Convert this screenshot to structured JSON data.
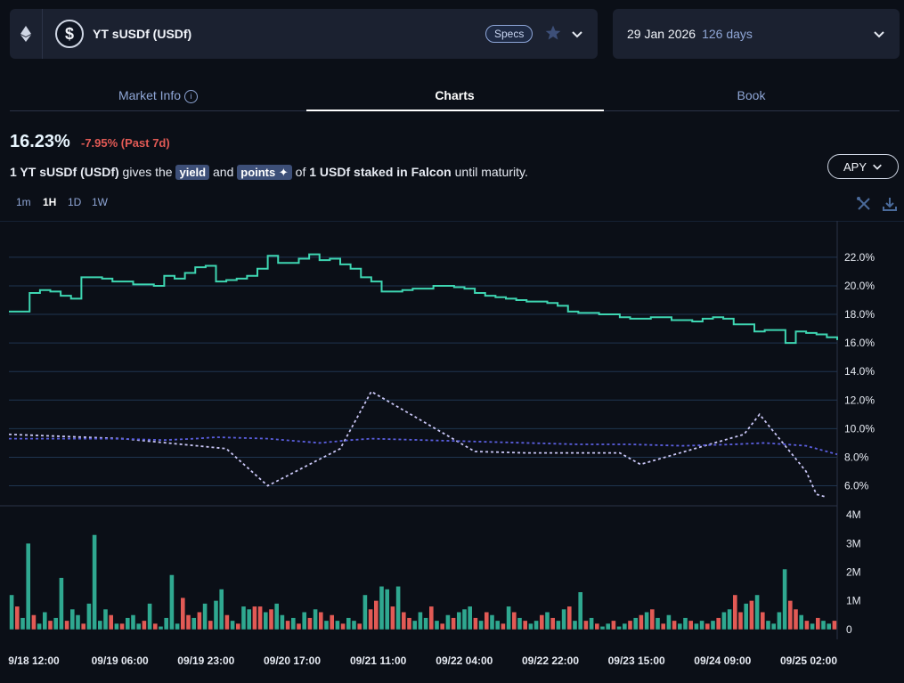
{
  "header": {
    "market_title": "YT sUSDf (USDf)",
    "specs_label": "Specs",
    "maturity_date": "29 Jan 2026",
    "days_left": "126 days"
  },
  "tabs": [
    {
      "label": "Market Info"
    },
    {
      "label": "Charts"
    },
    {
      "label": "Book"
    }
  ],
  "stats": {
    "apy_value": "16.23%",
    "apy_change": "-7.95% (Past 7d)"
  },
  "description": {
    "part1": "1 YT sUSDf (USDf)",
    "part2": " gives the ",
    "chip_yield": "yield",
    "part3": " and ",
    "chip_points": "points",
    "part4": " of ",
    "part5": "1 USDf staked in Falcon",
    "part6": " until maturity."
  },
  "metric_dropdown": {
    "label": "APY"
  },
  "time_ranges": [
    {
      "label": "1m"
    },
    {
      "label": "1H",
      "active": true
    },
    {
      "label": "1D"
    },
    {
      "label": "1W"
    }
  ],
  "colors": {
    "implied_line": "#3ed6b2",
    "underlying_dash": "#c9c6f5",
    "baseline_dash": "#5b5fe0",
    "vol_up": "#2fa890",
    "vol_down": "#e25a55"
  },
  "icons": [
    "eth-icon",
    "dollar-icon",
    "star-icon",
    "chevron-down-icon",
    "info-icon",
    "tools-icon",
    "download-icon"
  ],
  "chart_data": {
    "type": "line",
    "x_tick_labels": [
      "9/18 12:00",
      "09/19 06:00",
      "09/19 23:00",
      "09/20 17:00",
      "09/21 11:00",
      "09/22 04:00",
      "09/22 22:00",
      "09/23 15:00",
      "09/24 09:00",
      "09/25 02:00"
    ],
    "y_tick_labels": [
      "6.0%",
      "8.0%",
      "10.0%",
      "12.0%",
      "14.0%",
      "16.0%",
      "18.0%",
      "20.0%",
      "22.0%"
    ],
    "ylim": [
      4.6,
      23.3
    ],
    "x_range": [
      0,
      160
    ],
    "series": [
      {
        "kind": "step",
        "x": [
          0,
          4,
          6,
          8,
          10,
          12,
          14,
          16,
          18,
          20,
          22,
          24,
          26,
          28,
          30,
          32,
          34,
          36,
          38,
          40,
          42,
          44,
          46,
          48,
          50,
          52,
          54,
          56,
          58,
          60,
          62,
          64,
          66,
          68,
          70,
          72,
          74,
          76,
          78,
          80,
          82,
          84,
          86,
          88,
          90,
          92,
          94,
          96,
          98,
          100,
          102,
          104,
          106,
          108,
          110,
          112,
          114,
          116,
          118,
          120,
          122,
          124,
          126,
          128,
          130,
          132,
          134,
          136,
          138,
          140,
          142,
          144,
          146,
          148,
          150,
          152,
          154,
          156,
          158,
          160
        ],
        "y": [
          18.2,
          19.5,
          19.7,
          19.6,
          19.3,
          19.1,
          20.6,
          20.6,
          20.5,
          20.3,
          20.3,
          20.1,
          20.1,
          20.0,
          20.7,
          20.5,
          20.9,
          21.3,
          21.4,
          20.3,
          20.4,
          20.5,
          20.7,
          21.2,
          22.1,
          21.6,
          21.6,
          21.9,
          22.2,
          21.8,
          21.9,
          21.5,
          21.2,
          20.6,
          20.3,
          19.6,
          19.6,
          19.7,
          19.8,
          19.8,
          20.0,
          20.0,
          19.9,
          19.8,
          19.5,
          19.3,
          19.2,
          19.1,
          19.0,
          18.9,
          18.9,
          18.8,
          18.6,
          18.2,
          18.1,
          18.1,
          18.0,
          18.0,
          17.8,
          17.7,
          17.7,
          17.8,
          17.8,
          17.6,
          17.6,
          17.5,
          17.7,
          17.8,
          17.7,
          17.3,
          17.3,
          16.8,
          16.9,
          16.9,
          16.0,
          16.8,
          16.7,
          16.6,
          16.4,
          16.2
        ]
      },
      {
        "kind": "dashed",
        "x": [
          0,
          22,
          42,
          50,
          64,
          70,
          90,
          100,
          118,
          122,
          142,
          145,
          154,
          156,
          158
        ],
        "y": [
          9.6,
          9.3,
          8.6,
          6.0,
          8.6,
          12.6,
          8.4,
          8.3,
          8.3,
          7.5,
          9.6,
          11.0,
          7.0,
          5.4,
          5.2
        ]
      },
      {
        "kind": "dashed",
        "x": [
          0,
          10,
          20,
          30,
          36,
          40,
          50,
          60,
          66,
          70,
          80,
          90,
          100,
          110,
          120,
          130,
          140,
          146,
          154,
          160
        ],
        "y": [
          9.3,
          9.3,
          9.3,
          9.2,
          9.3,
          9.4,
          9.3,
          9.0,
          9.2,
          9.3,
          9.2,
          9.1,
          9.0,
          8.9,
          8.9,
          8.8,
          8.9,
          9.0,
          8.8,
          8.2
        ]
      }
    ],
    "volume": {
      "y_tick_labels": [
        "0",
        "1M",
        "2M",
        "3M",
        "4M"
      ],
      "ylim": [
        -0.1,
        4.1
      ],
      "values": [
        1.2,
        0.8,
        0.4,
        3.0,
        0.5,
        0.2,
        0.6,
        0.3,
        0.4,
        1.8,
        0.3,
        0.7,
        0.5,
        0.2,
        0.9,
        3.3,
        0.3,
        0.7,
        0.5,
        0.2,
        0.2,
        0.4,
        0.5,
        0.2,
        0.3,
        0.9,
        0.2,
        0.1,
        0.4,
        1.9,
        0.2,
        1.1,
        0.5,
        0.4,
        0.6,
        0.9,
        0.3,
        1.0,
        1.4,
        0.5,
        0.3,
        0.2,
        0.8,
        0.7,
        0.8,
        0.8,
        0.6,
        0.7,
        0.9,
        0.5,
        0.3,
        0.4,
        0.2,
        0.6,
        0.4,
        0.7,
        0.6,
        0.3,
        0.5,
        0.3,
        0.2,
        0.4,
        0.3,
        0.2,
        1.2,
        0.7,
        1.0,
        1.5,
        1.4,
        0.8,
        1.5,
        0.6,
        0.4,
        0.3,
        0.6,
        0.4,
        0.8,
        0.3,
        0.2,
        0.5,
        0.4,
        0.6,
        0.7,
        0.8,
        0.4,
        0.3,
        0.6,
        0.5,
        0.3,
        0.2,
        0.8,
        0.6,
        0.4,
        0.3,
        0.2,
        0.3,
        0.5,
        0.6,
        0.4,
        0.3,
        0.7,
        0.8,
        0.3,
        1.3,
        0.3,
        0.4,
        0.2,
        0.1,
        0.2,
        0.3,
        0.1,
        0.2,
        0.3,
        0.4,
        0.5,
        0.6,
        0.7,
        0.4,
        0.2,
        0.5,
        0.3,
        0.2,
        0.4,
        0.3,
        0.2,
        0.3,
        0.2,
        0.3,
        0.4,
        0.6,
        0.7,
        1.2,
        0.6,
        0.9,
        1.0,
        1.2,
        0.6,
        0.3,
        0.2,
        0.6,
        2.1,
        1.0,
        0.7,
        0.5,
        0.3,
        0.2,
        0.4,
        0.3,
        0.2,
        0.3
      ],
      "down_flags": [
        0,
        1,
        0,
        0,
        1,
        0,
        0,
        1,
        0,
        0,
        1,
        0,
        0,
        1,
        0,
        0,
        0,
        0,
        1,
        0,
        1,
        0,
        0,
        0,
        1,
        0,
        1,
        0,
        0,
        0,
        0,
        1,
        1,
        0,
        1,
        0,
        1,
        0,
        0,
        1,
        0,
        1,
        0,
        0,
        1,
        1,
        0,
        1,
        0,
        0,
        1,
        0,
        1,
        0,
        1,
        0,
        1,
        0,
        1,
        0,
        1,
        0,
        0,
        1,
        0,
        1,
        1,
        0,
        0,
        1,
        0,
        1,
        1,
        0,
        0,
        0,
        1,
        0,
        1,
        0,
        1,
        0,
        0,
        0,
        1,
        0,
        1,
        0,
        0,
        1,
        0,
        1,
        0,
        1,
        0,
        0,
        1,
        0,
        1,
        0,
        0,
        1,
        0,
        0,
        1,
        0,
        1,
        0,
        0,
        1,
        0,
        0,
        1,
        0,
        1,
        0,
        1,
        0,
        1,
        0,
        1,
        0,
        0,
        1,
        0,
        0,
        1,
        0,
        1,
        0,
        0,
        1,
        1,
        0,
        1,
        0,
        1,
        0,
        0,
        0,
        0,
        1,
        1,
        0,
        1,
        0,
        1,
        0,
        0,
        1
      ]
    }
  }
}
